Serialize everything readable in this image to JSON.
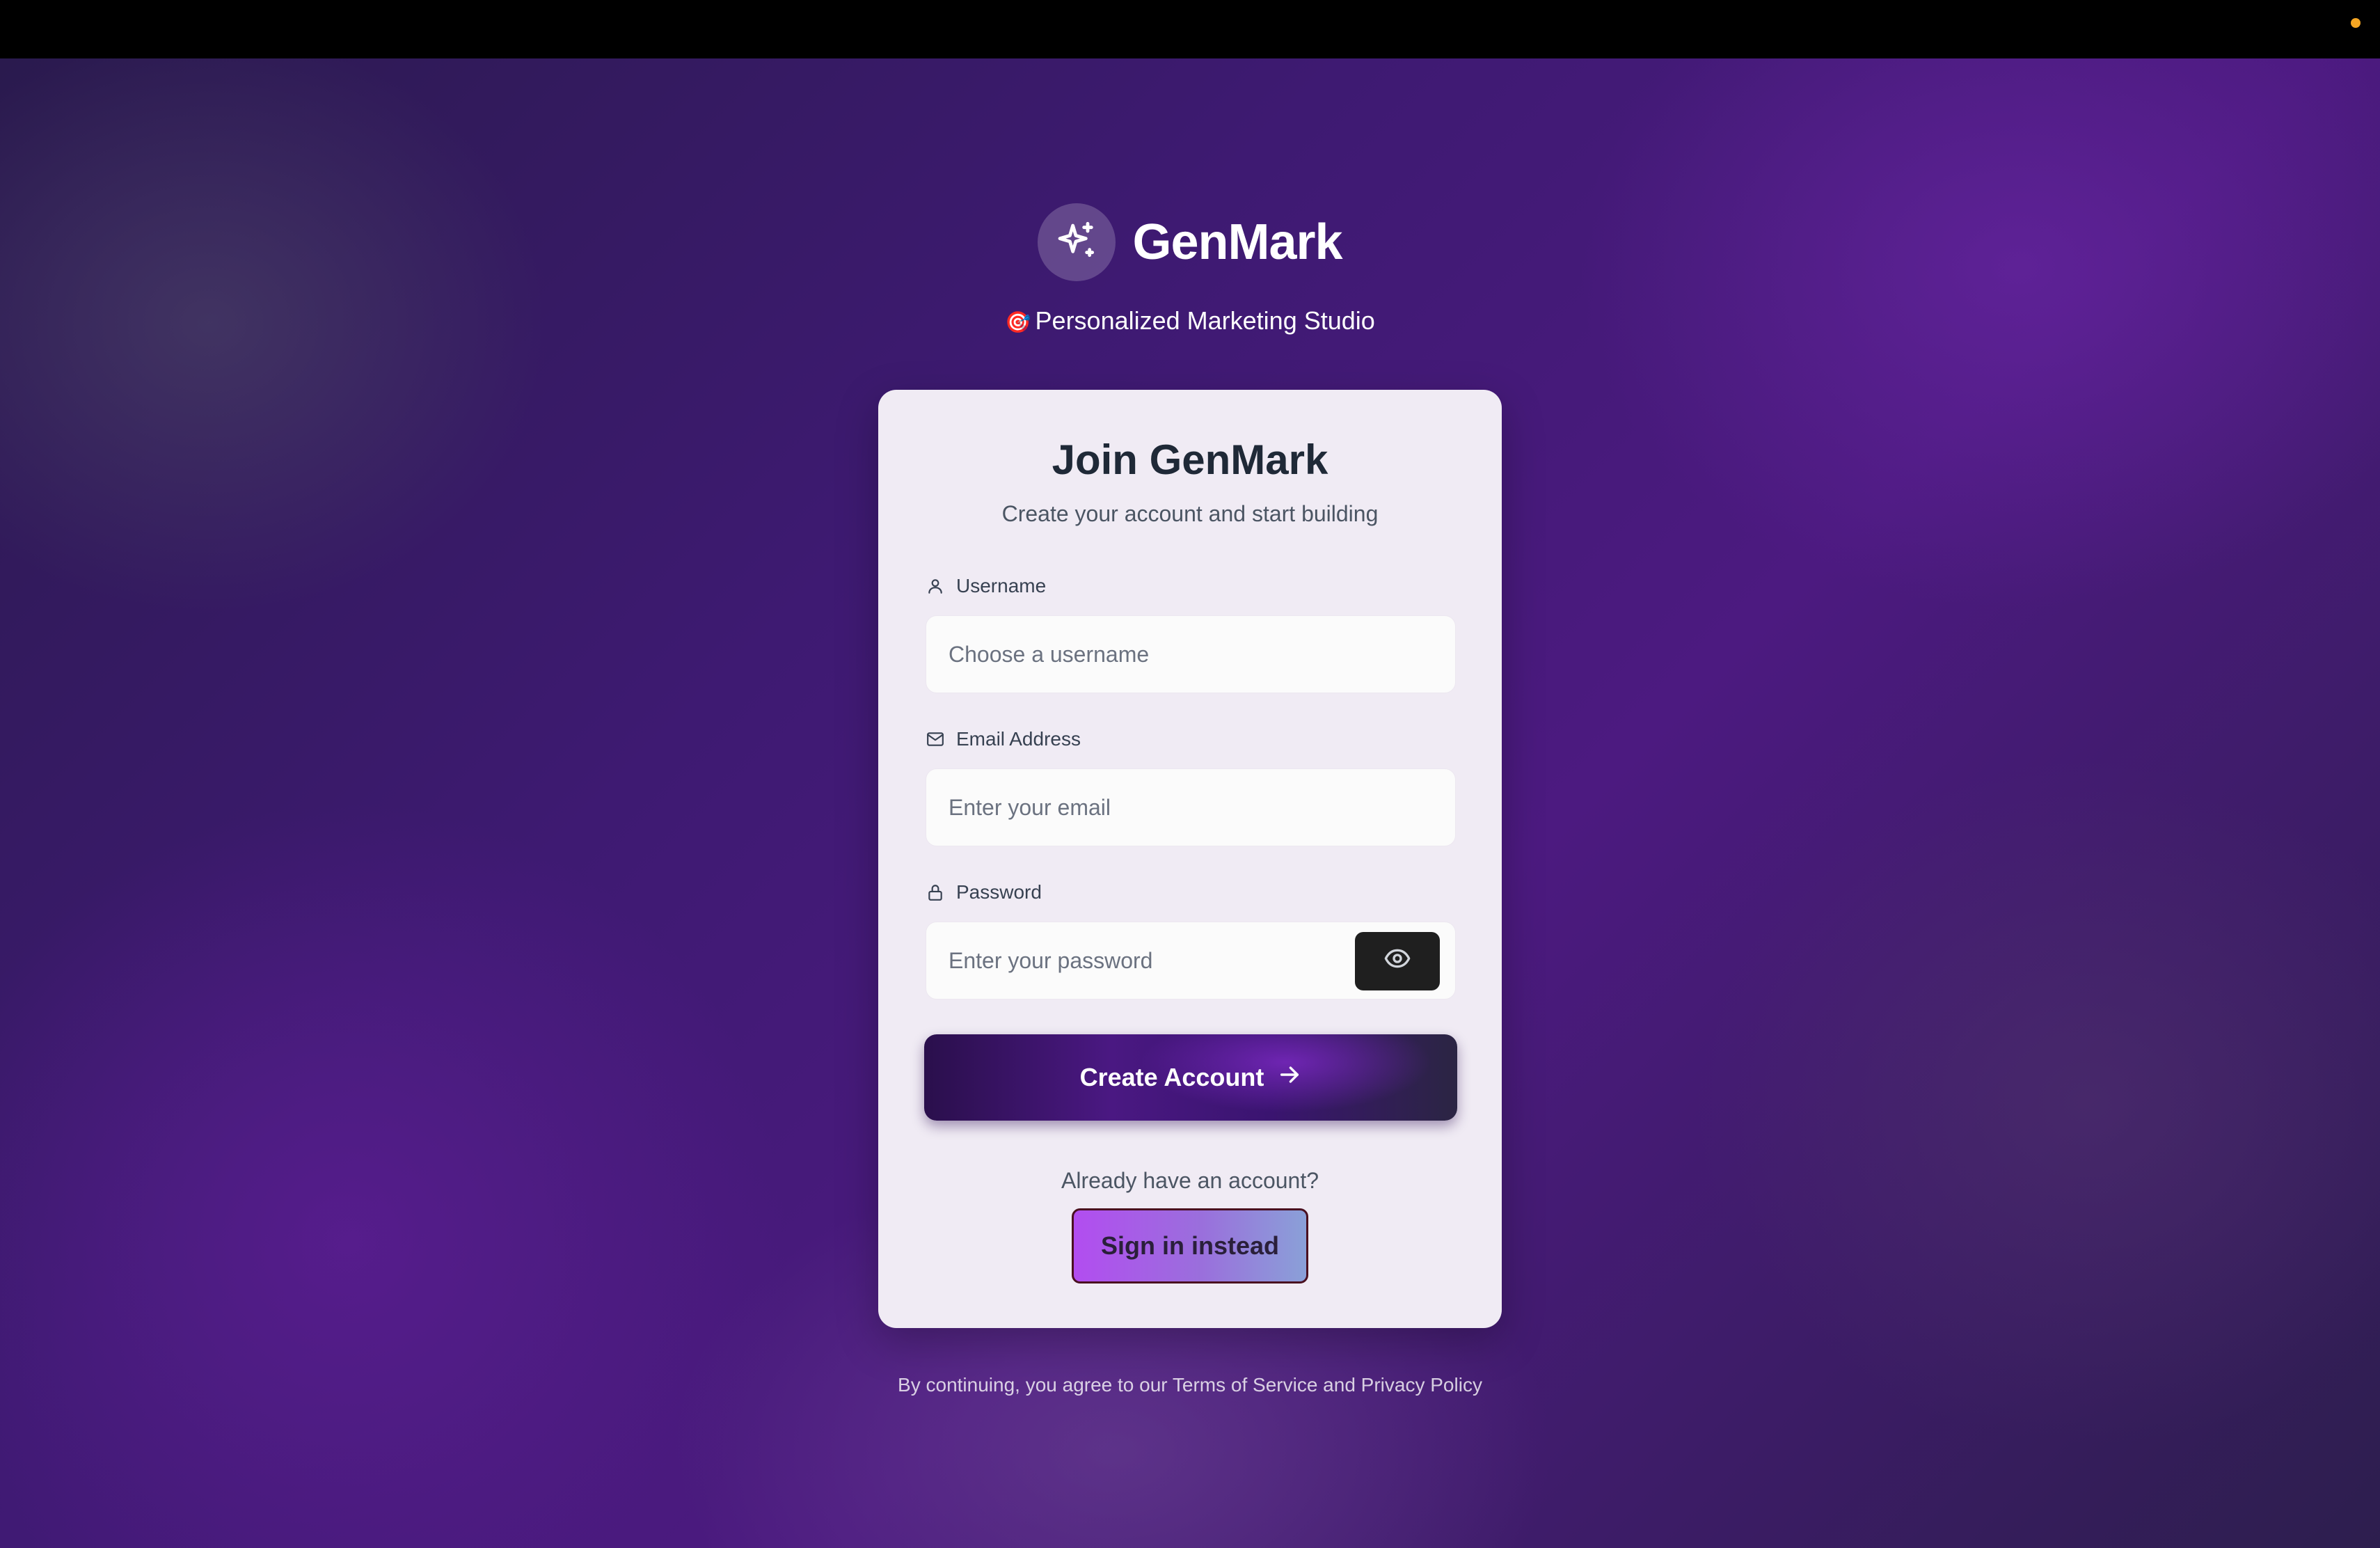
{
  "brand": {
    "name": "GenMark",
    "tagline_emoji": "🎯",
    "tagline": "Personalized Marketing Studio"
  },
  "card": {
    "title": "Join GenMark",
    "subtitle": "Create your account and start building"
  },
  "form": {
    "username": {
      "label": "Username",
      "icon": "user-icon",
      "placeholder": "Choose a username"
    },
    "email": {
      "label": "Email Address",
      "icon": "mail-icon",
      "placeholder": "Enter your email"
    },
    "password": {
      "label": "Password",
      "icon": "lock-icon",
      "placeholder": "Enter your password",
      "toggle_icon": "eye-icon"
    },
    "submit_label": "Create Account",
    "submit_icon": "arrow-right-icon"
  },
  "signin": {
    "prompt": "Already have an account?",
    "button_label": "Sign in instead"
  },
  "footer": {
    "text": "By continuing, you agree to our Terms of Service and Privacy Policy"
  },
  "colors": {
    "card_bg": "#f0ebf4",
    "primary_dark": "#2a0f4c",
    "primary_accent": "#4a1882",
    "signin_gradient_start": "#b24df0",
    "signin_gradient_end": "#8aa0d8",
    "status_dot": "#f5a623"
  }
}
